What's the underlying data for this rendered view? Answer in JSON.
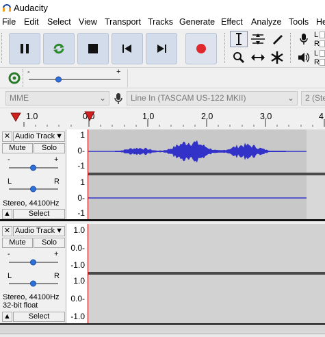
{
  "window": {
    "title": "Audacity"
  },
  "menu": [
    "File",
    "Edit",
    "Select",
    "View",
    "Transport",
    "Tracks",
    "Generate",
    "Effect",
    "Analyze",
    "Tools",
    "He"
  ],
  "transport": {
    "pause_icon": "pause-icon",
    "loop_icon": "loop-icon",
    "stop_icon": "stop-icon",
    "skip_start_icon": "skip-to-start-icon",
    "skip_end_icon": "skip-to-end-icon",
    "record_icon": "record-icon",
    "record_color": "#e0292c"
  },
  "meters": {
    "rec_L": "L",
    "rec_R": "R",
    "play_L": "L",
    "play_R": "R"
  },
  "gain_slider": {
    "min_label": "-",
    "max_label": "+"
  },
  "device": {
    "host": "MME",
    "input": "Line In (TASCAM US-122 MKII)",
    "channels": "2 (Ste"
  },
  "timeline": {
    "ticks": [
      "1.0",
      "0.0",
      "1.0",
      "2.0",
      "3.0",
      "4"
    ]
  },
  "tracks": [
    {
      "name": "Audio Track",
      "mute": "Mute",
      "solo": "Solo",
      "gain_min": "-",
      "gain_max": "+",
      "pan_l": "L",
      "pan_r": "R",
      "info_line1": "Stereo, 44100Hz",
      "info_line2": "",
      "select": "Select",
      "ruler_top": [
        "1",
        "0-",
        "-1"
      ],
      "ruler_bottom": [
        "1",
        "0-",
        "-1"
      ]
    },
    {
      "name": "Audio Track",
      "mute": "Mute",
      "solo": "Solo",
      "gain_min": "-",
      "gain_max": "+",
      "pan_l": "L",
      "pan_r": "R",
      "info_line1": "Stereo, 44100Hz",
      "info_line2": "32-bit float",
      "select": "Select",
      "ruler_top": [
        "1.0",
        "0.0-",
        "-1.0"
      ],
      "ruler_bottom": [
        "1.0",
        "0.0-",
        "-1.0"
      ]
    }
  ],
  "colors": {
    "waveform": "#3232c8",
    "track_bg": "#c8c8c8",
    "track_bg_empty": "#d2d2d2",
    "cursor": "#c00000",
    "button_bg": "#d3dcea"
  }
}
